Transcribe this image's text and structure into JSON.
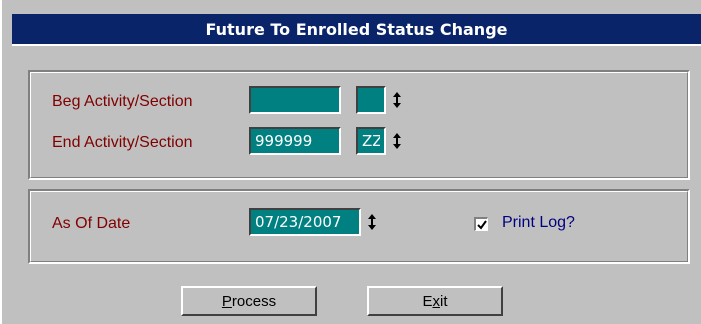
{
  "window": {
    "title": "Future To Enrolled Status Change"
  },
  "range": {
    "beg_label": "Beg Activity/Section",
    "beg_activity_value": "",
    "beg_section_value": "",
    "end_label": "End Activity/Section",
    "end_activity_value": "999999",
    "end_section_value": "ZZ"
  },
  "options": {
    "as_of_label": "As Of Date",
    "as_of_value": "07/23/2007",
    "print_log_label": "Print Log?",
    "print_log_checked": true
  },
  "buttons": {
    "process_mnemonic": "P",
    "process_rest": "rocess",
    "exit_pre": "E",
    "exit_mnemonic": "x",
    "exit_rest": "it"
  },
  "icons": {
    "spinner": "up-down-arrow-icon",
    "check": "checkmark-icon"
  },
  "colors": {
    "title_bar": "#0a246a",
    "field_bg": "#008080",
    "label": "#800000",
    "checkbox_label": "#000080",
    "window_bg": "#c0c0c0"
  }
}
